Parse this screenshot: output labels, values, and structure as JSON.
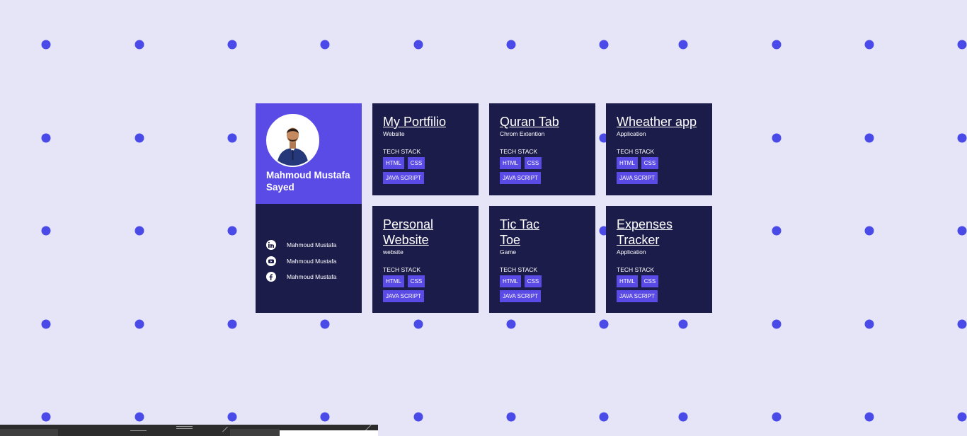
{
  "profile": {
    "name": "Mahmoud Mustafa Sayed",
    "avatar_icon": "user-photo",
    "socials": [
      {
        "icon": "linkedin-icon",
        "label": "Mahmoud Mustafa"
      },
      {
        "icon": "youtube-icon",
        "label": "Mahmoud Mustafa"
      },
      {
        "icon": "facebook-icon",
        "label": "Mahmoud Mustafa"
      }
    ]
  },
  "projects": [
    {
      "title": "My Portfilio",
      "type": "Website",
      "stack_label": "TECH STACK",
      "tags": [
        "HTML",
        "CSS",
        "JAVA SCRIPT"
      ]
    },
    {
      "title": "Quran Tab",
      "type": "Chrom Extention",
      "stack_label": "TECH STACK",
      "tags": [
        "HTML",
        "CSS",
        "JAVA SCRIPT"
      ]
    },
    {
      "title": "Wheather app",
      "type": "Application",
      "stack_label": "TECH STACK",
      "tags": [
        "HTML",
        "CSS",
        "JAVA SCRIPT"
      ]
    },
    {
      "title": "Personal Website",
      "type": "website",
      "stack_label": "TECH STACK",
      "tags": [
        "HTML",
        "CSS",
        "JAVA SCRIPT"
      ]
    },
    {
      "title": "Tic Tac Toe",
      "type": "Game",
      "stack_label": "TECH STACK",
      "tags": [
        "HTML",
        "CSS",
        "JAVA SCRIPT"
      ]
    },
    {
      "title": "Expenses Tracker",
      "type": "Application",
      "stack_label": "TECH STACK",
      "tags": [
        "HTML",
        "CSS",
        "JAVA SCRIPT"
      ]
    }
  ],
  "colors": {
    "background": "#e6e4f7",
    "dot": "#4a4ae8",
    "card": "#1c1c4b",
    "accent": "#5a4ae6"
  }
}
